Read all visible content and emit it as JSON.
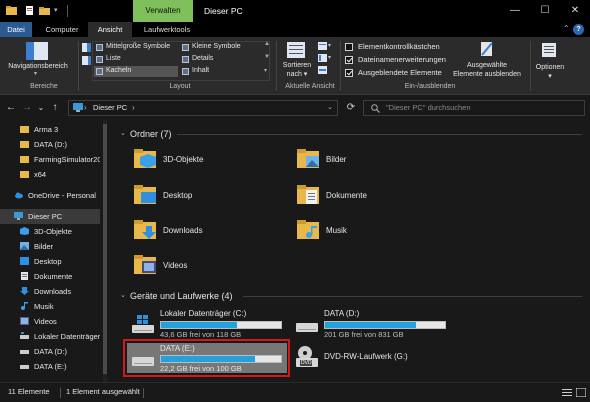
{
  "window": {
    "context_tab": "Verwalten",
    "title": "Dieser PC",
    "minimize": "—",
    "maximize": "☐",
    "close": "✕"
  },
  "ribbon_tabs": [
    "Datei",
    "Computer",
    "Ansicht",
    "Laufwerktools"
  ],
  "ribbon": {
    "navigation_pane": "Navigationsbereich",
    "group_panes": "Bereiche",
    "layout_items": {
      "medium_icons": "Mittelgroße Symbole",
      "small_icons": "Kleine Symbole",
      "list": "Liste",
      "details": "Details",
      "tiles": "Kacheln",
      "content": "Inhalt"
    },
    "group_layout": "Layout",
    "sort_label": "Sortieren nach",
    "sort_line1": "Sortieren",
    "sort_line2": "nach",
    "group_current_view": "Aktuelle Ansicht",
    "checkboxes": [
      {
        "label": "Elementkontrollkästchen",
        "checked": false
      },
      {
        "label": "Dateinamenerweiterungen",
        "checked": true
      },
      {
        "label": "Ausgeblendete Elemente",
        "checked": true
      }
    ],
    "hide_selected_line1": "Ausgewählte",
    "hide_selected_line2": "Elemente ausblenden",
    "group_show_hide": "Ein-/ausblenden",
    "options": "Optionen"
  },
  "address": {
    "back": "←",
    "forward": "→",
    "down": "⌄",
    "up": "↑",
    "path": "Dieser PC",
    "chevron": "›",
    "search_placeholder": "\"Dieser PC\" durchsuchen"
  },
  "sidebar": [
    {
      "label": "Arma 3",
      "icon": "folder-icon"
    },
    {
      "label": "DATA (D:)",
      "icon": "folder-icon"
    },
    {
      "label": "FarmingSimulator20",
      "icon": "folder-icon"
    },
    {
      "label": "x64",
      "icon": "folder-icon"
    },
    {
      "label": "OneDrive - Personal",
      "icon": "cloud-icon"
    },
    {
      "label": "Dieser PC",
      "icon": "computer-icon"
    },
    {
      "label": "3D-Objekte",
      "icon": "objects-icon"
    },
    {
      "label": "Bilder",
      "icon": "pictures-icon"
    },
    {
      "label": "Desktop",
      "icon": "desktop-icon"
    },
    {
      "label": "Dokumente",
      "icon": "documents-icon"
    },
    {
      "label": "Downloads",
      "icon": "downloads-icon"
    },
    {
      "label": "Musik",
      "icon": "music-icon"
    },
    {
      "label": "Videos",
      "icon": "videos-icon"
    },
    {
      "label": "Lokaler Datenträger",
      "icon": "drive-icon"
    },
    {
      "label": "DATA (D:)",
      "icon": "drive-icon"
    },
    {
      "label": "DATA (E:)",
      "icon": "drive-icon"
    }
  ],
  "folders_header": "Ordner (7)",
  "folders": [
    {
      "name": "3D-Objekte",
      "icon": "objects-folder-icon"
    },
    {
      "name": "Bilder",
      "icon": "pictures-folder-icon"
    },
    {
      "name": "Desktop",
      "icon": "desktop-folder-icon"
    },
    {
      "name": "Dokumente",
      "icon": "documents-folder-icon"
    },
    {
      "name": "Downloads",
      "icon": "downloads-folder-icon"
    },
    {
      "name": "Musik",
      "icon": "music-folder-icon"
    },
    {
      "name": "Videos",
      "icon": "videos-folder-icon"
    }
  ],
  "drives_header": "Geräte und Laufwerke (4)",
  "drives": [
    {
      "name": "Lokaler Datenträger (C:)",
      "free": "43,6 GB frei von 118 GB",
      "used_fraction": 0.63,
      "selected": false
    },
    {
      "name": "DATA (D:)",
      "free": "201 GB frei von 831 GB",
      "used_fraction": 0.76,
      "selected": false
    },
    {
      "name": "DATA (E:)",
      "free": "22,2 GB frei von 100 GB",
      "used_fraction": 0.78,
      "selected": true
    },
    {
      "name": "DVD-RW-Laufwerk (G:)",
      "free": "",
      "used_fraction": null,
      "selected": false
    }
  ],
  "dvd_badge": "DVD",
  "status": {
    "count": "11 Elemente",
    "selected": "1 Element ausgewählt"
  },
  "colors": {
    "accent": "#26a0da",
    "context_tab": "#7fbf5c",
    "file_tab": "#2b5a91",
    "highlight": "#d41818",
    "folder": "#e8b84a"
  }
}
